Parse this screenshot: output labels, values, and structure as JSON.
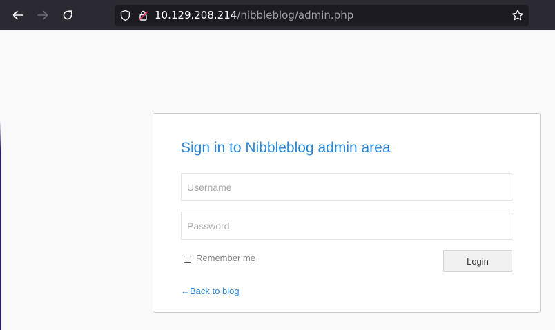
{
  "browser": {
    "url_host": "10.129.208.214",
    "url_path": "/nibbleblog/admin.php",
    "icons": {
      "back": "back-arrow-icon",
      "forward": "forward-arrow-icon",
      "reload": "reload-icon",
      "shield": "shield-icon",
      "lock": "lock-insecure-icon",
      "bookmark": "star-icon"
    }
  },
  "login": {
    "title": "Sign in to Nibbleblog admin area",
    "username_placeholder": "Username",
    "username_value": "",
    "password_placeholder": "Password",
    "password_value": "",
    "remember_label": "Remember me",
    "remember_checked": false,
    "login_button": "Login",
    "back_link": "←Back to blog"
  },
  "colors": {
    "accent": "#2a86d4",
    "chrome_bg": "#2b2a33",
    "page_bg": "#f9f9f9"
  }
}
